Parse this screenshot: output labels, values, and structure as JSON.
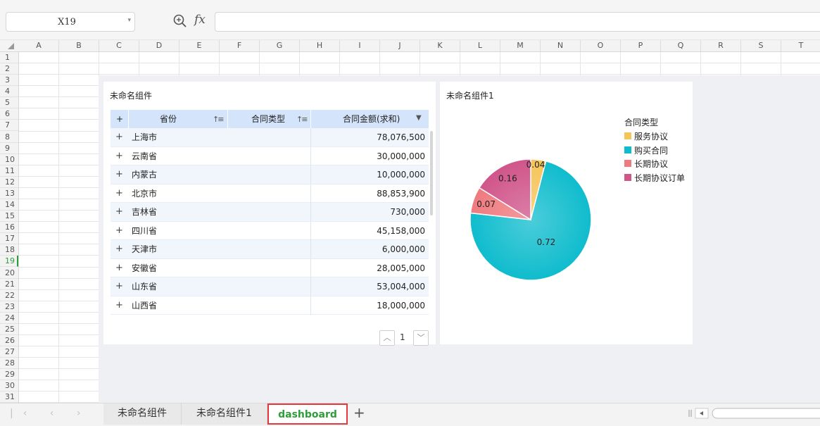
{
  "formula_bar": {
    "cell_ref": "X19",
    "zoom_icon": "zoom-search-icon",
    "fx_label": "fx",
    "formula": ""
  },
  "columns": [
    "A",
    "B",
    "C",
    "D",
    "E",
    "F",
    "G",
    "H",
    "I",
    "J",
    "K",
    "L",
    "M",
    "N",
    "O",
    "P",
    "Q",
    "R",
    "S",
    "T"
  ],
  "rows": [
    "1",
    "2",
    "3",
    "4",
    "5",
    "6",
    "7",
    "8",
    "9",
    "10",
    "11",
    "12",
    "13",
    "14",
    "15",
    "16",
    "17",
    "18",
    "19",
    "20",
    "21",
    "22",
    "23",
    "24",
    "25",
    "26",
    "27",
    "28",
    "29",
    "30",
    "31"
  ],
  "selected_row": "19",
  "table_widget": {
    "title": "未命名组件",
    "headers": {
      "expand": "+",
      "province": "省份",
      "contract_type": "合同类型",
      "amount": "合同金额(求和)"
    },
    "rows": [
      {
        "province": "上海市",
        "amount": "78,076,500"
      },
      {
        "province": "云南省",
        "amount": "30,000,000"
      },
      {
        "province": "内蒙古",
        "amount": "10,000,000"
      },
      {
        "province": "北京市",
        "amount": "88,853,900"
      },
      {
        "province": "吉林省",
        "amount": "730,000"
      },
      {
        "province": "四川省",
        "amount": "45,158,000"
      },
      {
        "province": "天津市",
        "amount": "6,000,000"
      },
      {
        "province": "安徽省",
        "amount": "28,005,000"
      },
      {
        "province": "山东省",
        "amount": "53,004,000"
      },
      {
        "province": "山西省",
        "amount": "18,000,000"
      }
    ],
    "pager": {
      "page": "1"
    }
  },
  "pie_widget": {
    "title": "未命名组件1",
    "legend_title": "合同类型"
  },
  "chart_data": {
    "type": "pie",
    "title": "未命名组件1",
    "legend_title": "合同类型",
    "legend_position": "top-right",
    "slices": [
      {
        "label": "服务协议",
        "value": 0.04,
        "color": "#f6c55a"
      },
      {
        "label": "购买合同",
        "value": 0.72,
        "color": "#0fbccd"
      },
      {
        "label": "长期协议",
        "value": 0.07,
        "color": "#ef7a7f"
      },
      {
        "label": "长期协议订单",
        "value": 0.16,
        "color": "#d0558a"
      }
    ]
  },
  "sheet_tabs": [
    {
      "label": "未命名组件",
      "active": false
    },
    {
      "label": "未命名组件1",
      "active": false
    },
    {
      "label": "dashboard",
      "active": true
    }
  ],
  "add_tab_label": "+"
}
